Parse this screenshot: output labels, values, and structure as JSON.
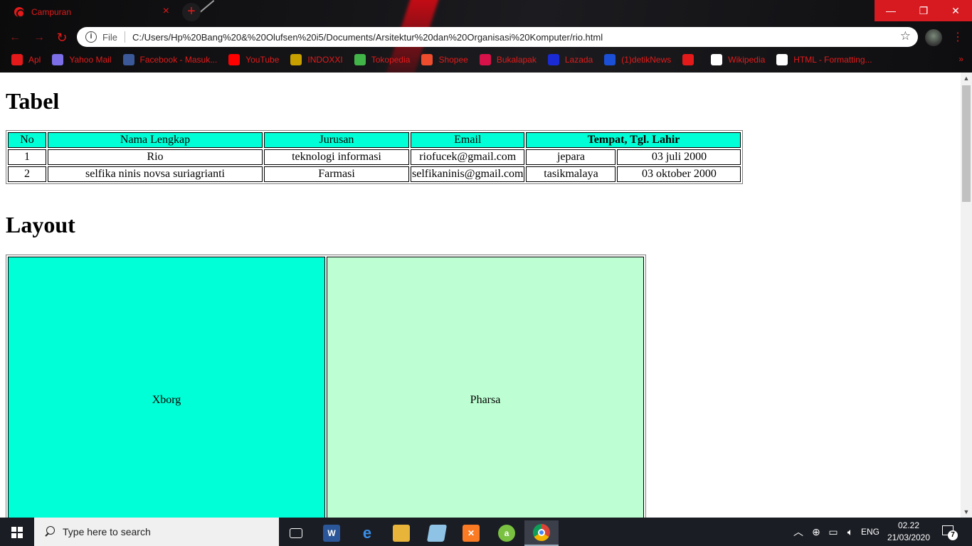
{
  "browser": {
    "tab_title": "Campuran",
    "tab_close": "×",
    "new_tab": "+",
    "file_label": "File",
    "url": "C:/Users/Hp%20Bang%20&%20Olufsen%20i5/Documents/Arsitektur%20dan%20Organisasi%20Komputer/rio.html",
    "window_controls": {
      "minimize": "—",
      "maximize": "❐",
      "close": "✕"
    },
    "nav": {
      "back": "←",
      "forward": "→",
      "reload": "↻"
    },
    "star": "☆",
    "menu": "⋮",
    "bookmarks": [
      {
        "label": "Apl",
        "icon": "apps-grid-icon",
        "color": "#e41a1a"
      },
      {
        "label": "Yahoo Mail",
        "icon": "mail-icon",
        "color": "#7b6ee6"
      },
      {
        "label": "Facebook - Masuk...",
        "icon": "facebook-icon",
        "color": "#3b5998"
      },
      {
        "label": "YouTube",
        "icon": "youtube-icon",
        "color": "#ff0000"
      },
      {
        "label": "INDOXXI",
        "icon": "indoxxi-icon",
        "color": "#c8a000"
      },
      {
        "label": "Tokopedia",
        "icon": "tokopedia-icon",
        "color": "#42b549"
      },
      {
        "label": "Shopee",
        "icon": "shopee-icon",
        "color": "#ee4d2d"
      },
      {
        "label": "Bukalapak",
        "icon": "bukalapak-icon",
        "color": "#d71149"
      },
      {
        "label": "Lazada",
        "icon": "lazada-icon",
        "color": "#1a2bd6"
      },
      {
        "label": "(1)detikNews",
        "icon": "detik-icon",
        "color": "#1a4fd6"
      },
      {
        "label": "",
        "icon": "globe-red-icon",
        "color": "#e41a1a"
      },
      {
        "label": "Wikipedia",
        "icon": "wikipedia-icon",
        "color": "#ffffff"
      },
      {
        "label": "HTML - Formatting...",
        "icon": "w3-icon",
        "color": "#ffffff"
      }
    ],
    "bookmarks_more": "»"
  },
  "page": {
    "heading_tabel": "Tabel",
    "heading_layout": "Layout",
    "table": {
      "headers": [
        "No",
        "Nama Lengkap",
        "Jurusan",
        "Email",
        "Tempat, Tgl. Lahir"
      ],
      "rows": [
        [
          "1",
          "Rio",
          "teknologi informasi",
          "riofucek@gmail.com",
          "jepara",
          "03 juli 2000"
        ],
        [
          "2",
          "selfika ninis novsa suriagrianti",
          "Farmasi",
          "selfikaninis@gmail.com",
          "tasikmalaya",
          "03 oktober 2000"
        ]
      ],
      "header_color": "#00ffd6"
    },
    "layout": {
      "left": "Xborg",
      "right": "Pharsa",
      "left_color": "#00ffd6",
      "right_color": "#bdffd2"
    }
  },
  "taskbar": {
    "search_placeholder": "Type here to search",
    "apps": [
      "task-view-icon",
      "word-icon",
      "edge-icon",
      "file-explorer-icon",
      "notes-icon",
      "xampp-icon",
      "aptana-icon",
      "chrome-icon"
    ],
    "tray": {
      "language": "ENG",
      "time": "02.22",
      "date": "21/03/2020",
      "notifications": "7"
    }
  }
}
